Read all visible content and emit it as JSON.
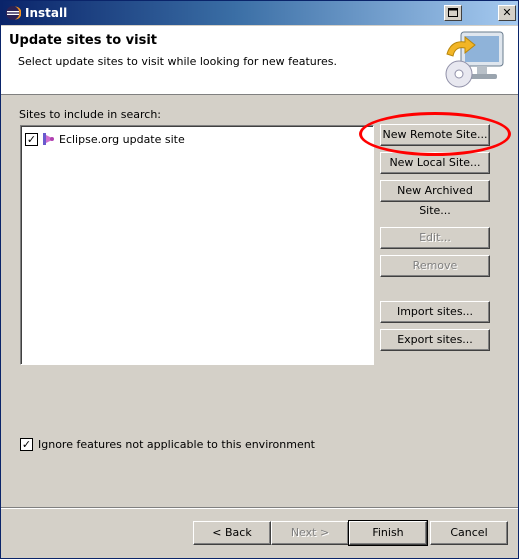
{
  "window": {
    "title": "Install"
  },
  "header": {
    "title": "Update sites to visit",
    "description": "Select update sites to visit while looking for new features."
  },
  "sites": {
    "label": "Sites to include in search:",
    "items": [
      {
        "label": "Eclipse.org update site",
        "checked": true
      }
    ]
  },
  "side_buttons": {
    "new_remote": "New Remote Site...",
    "new_local": "New Local Site...",
    "new_archived": "New Archived Site...",
    "edit": "Edit...",
    "remove": "Remove",
    "import": "Import sites...",
    "export": "Export sites..."
  },
  "options": {
    "ignore_label": "Ignore features not applicable to this environment",
    "ignore_checked": true
  },
  "footer": {
    "back": "< Back",
    "next": "Next >",
    "finish": "Finish",
    "cancel": "Cancel"
  },
  "colors": {
    "titlebar": "#0a246a",
    "annotation": "#ff0000"
  }
}
